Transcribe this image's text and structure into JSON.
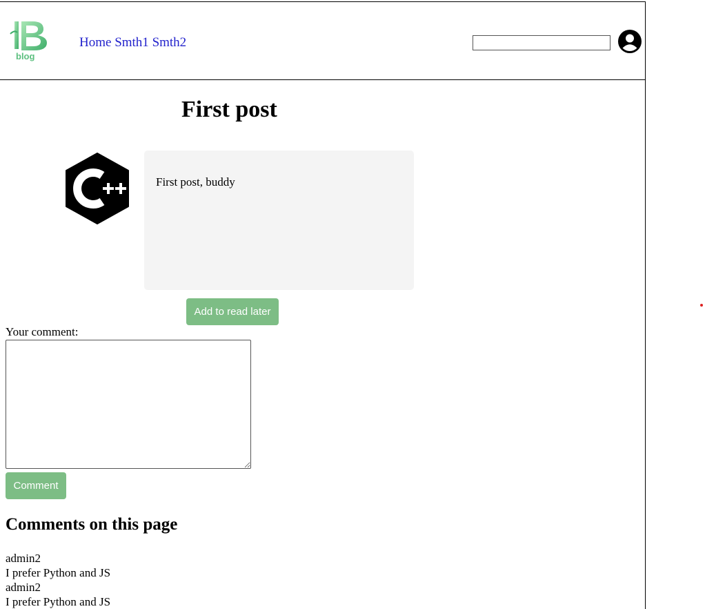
{
  "header": {
    "logo_text": "blog",
    "nav": [
      {
        "label": "Home"
      },
      {
        "label": "Smth1"
      },
      {
        "label": "Smth2"
      }
    ],
    "search": {
      "value": "",
      "placeholder": ""
    }
  },
  "post": {
    "title": "First post",
    "icon": "cpp-logo-icon",
    "body": "First post, buddy",
    "read_later_label": "Add to read later"
  },
  "comment_form": {
    "label": "Your comment:",
    "value": "",
    "submit_label": "Comment"
  },
  "comments_section": {
    "heading": "Comments on this page",
    "comments": [
      {
        "author": "admin2",
        "text": "I prefer Python and JS"
      },
      {
        "author": "admin2",
        "text": "I prefer Python and JS"
      }
    ]
  },
  "colors": {
    "button": "#7dbd85",
    "link": "#2222cc",
    "post_body_bg": "#f4f4f4"
  }
}
